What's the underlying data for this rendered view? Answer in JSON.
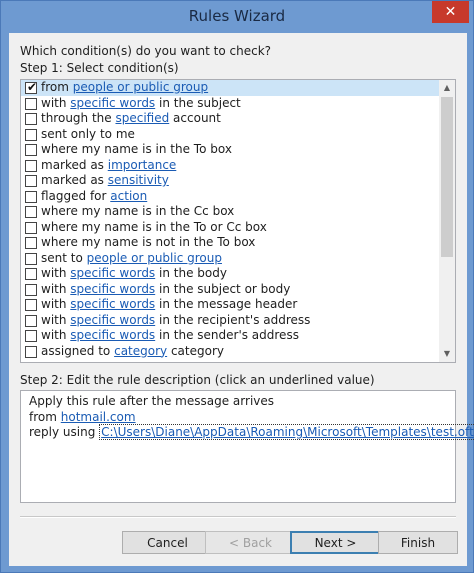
{
  "window": {
    "title": "Rules Wizard",
    "close_label": "✕"
  },
  "step1": {
    "question": "Which condition(s) do you want to check?",
    "label": "Step 1: Select condition(s)",
    "conditions": [
      {
        "checked": true,
        "pre": "from ",
        "link": "people or public group",
        "post": ""
      },
      {
        "checked": false,
        "pre": "with ",
        "link": "specific words",
        "post": " in the subject"
      },
      {
        "checked": false,
        "pre": "through the ",
        "link": "specified",
        "post": " account"
      },
      {
        "checked": false,
        "pre": "sent only to me",
        "link": "",
        "post": ""
      },
      {
        "checked": false,
        "pre": "where my name is in the To box",
        "link": "",
        "post": ""
      },
      {
        "checked": false,
        "pre": "marked as ",
        "link": "importance",
        "post": ""
      },
      {
        "checked": false,
        "pre": "marked as ",
        "link": "sensitivity",
        "post": ""
      },
      {
        "checked": false,
        "pre": "flagged for ",
        "link": "action",
        "post": ""
      },
      {
        "checked": false,
        "pre": "where my name is in the Cc box",
        "link": "",
        "post": ""
      },
      {
        "checked": false,
        "pre": "where my name is in the To or Cc box",
        "link": "",
        "post": ""
      },
      {
        "checked": false,
        "pre": "where my name is not in the To box",
        "link": "",
        "post": ""
      },
      {
        "checked": false,
        "pre": "sent to ",
        "link": "people or public group",
        "post": ""
      },
      {
        "checked": false,
        "pre": "with ",
        "link": "specific words",
        "post": " in the body"
      },
      {
        "checked": false,
        "pre": "with ",
        "link": "specific words",
        "post": " in the subject or body"
      },
      {
        "checked": false,
        "pre": "with ",
        "link": "specific words",
        "post": " in the message header"
      },
      {
        "checked": false,
        "pre": "with ",
        "link": "specific words",
        "post": " in the recipient's address"
      },
      {
        "checked": false,
        "pre": "with ",
        "link": "specific words",
        "post": " in the sender's address"
      },
      {
        "checked": false,
        "pre": "assigned to ",
        "link": "category",
        "post": " category"
      }
    ]
  },
  "step2": {
    "label": "Step 2: Edit the rule description (click an underlined value)",
    "line1": "Apply this rule after the message arrives",
    "line2_pre": "from ",
    "line2_link": "hotmail.com",
    "line3_pre": "reply using ",
    "line3_link": "C:\\Users\\Diane\\AppData\\Roaming\\Microsoft\\Templates\\test.oft"
  },
  "buttons": {
    "cancel": "Cancel",
    "back": "< Back",
    "next": "Next >",
    "finish": "Finish"
  },
  "scrollbar": {
    "up_arrow": "▲",
    "down_arrow": "▼"
  },
  "check_glyph": "✔",
  "colors": {
    "titlebar": "#6e9ad1",
    "close": "#c7392b",
    "link": "#1a5bb4",
    "selection": "#cce4f7"
  }
}
